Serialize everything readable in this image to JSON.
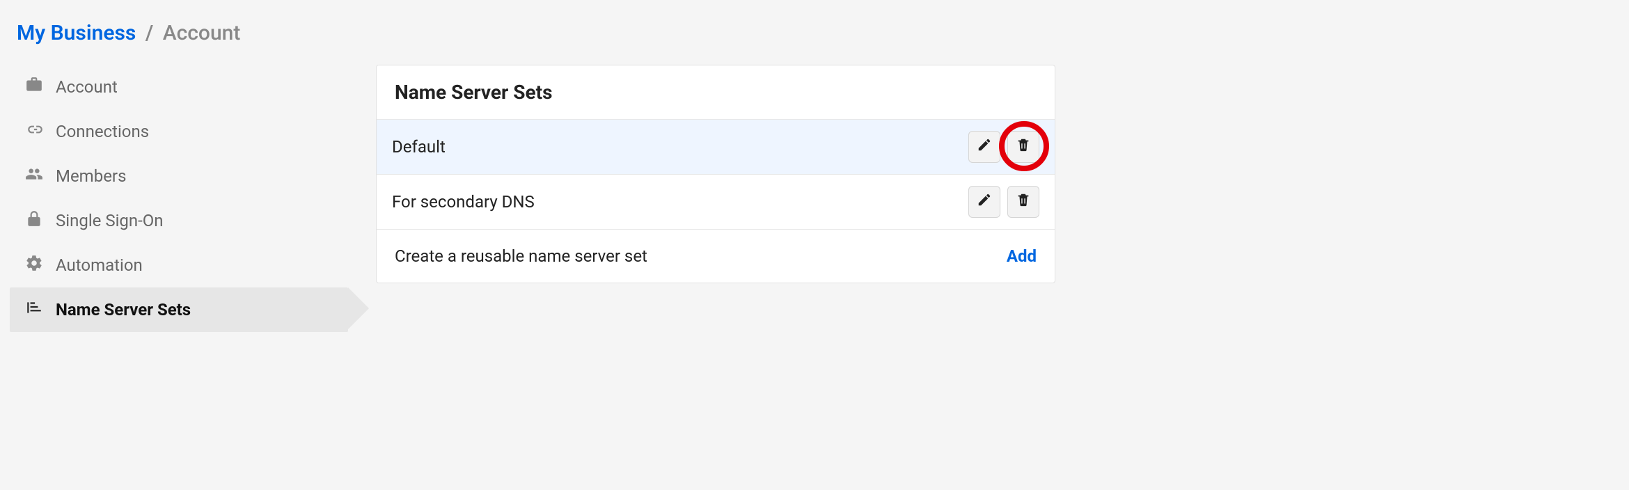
{
  "breadcrumb": {
    "root": "My Business",
    "separator": "/",
    "current": "Account"
  },
  "sidebar": {
    "items": [
      {
        "label": "Account"
      },
      {
        "label": "Connections"
      },
      {
        "label": "Members"
      },
      {
        "label": "Single Sign-On"
      },
      {
        "label": "Automation"
      },
      {
        "label": "Name Server Sets"
      }
    ]
  },
  "panel": {
    "title": "Name Server Sets",
    "rows": [
      {
        "name": "Default"
      },
      {
        "name": "For secondary DNS"
      }
    ],
    "footer_text": "Create a reusable name server set",
    "add_label": "Add"
  }
}
